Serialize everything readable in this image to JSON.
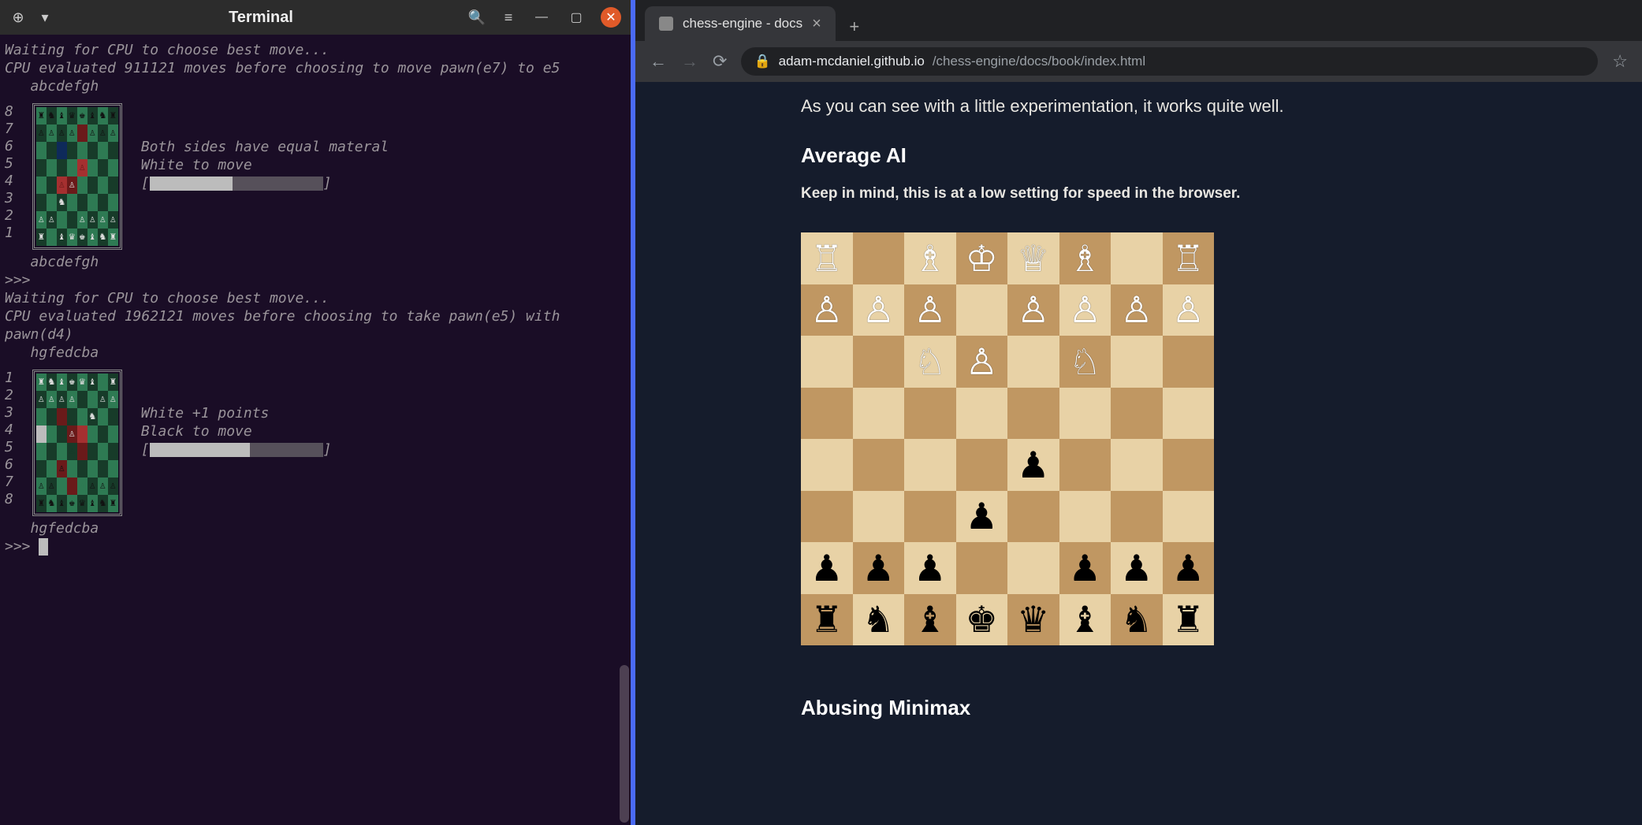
{
  "terminal": {
    "title": "Terminal",
    "lines_top": [
      "Waiting for CPU to choose best move...",
      "CPU evaluated 911121 moves before choosing to move pawn(e7) to e5",
      "   abcdefgh"
    ],
    "board1": {
      "ranks": [
        "8",
        "7",
        "6",
        "5",
        "4",
        "3",
        "2",
        "1"
      ],
      "files_label": "   abcdefgh",
      "side": {
        "status": "Both sides have equal materal",
        "turn": "White to move",
        "bar_open": "[",
        "bar_close": "]",
        "progress_pct": 48
      },
      "squares": [
        [
          {
            "c": "#2e7a53",
            "g": "♜",
            "gc": "#111"
          },
          {
            "c": "#173b29",
            "g": "♞",
            "gc": "#111"
          },
          {
            "c": "#2e7a53",
            "g": "♝",
            "gc": "#111"
          },
          {
            "c": "#173b29",
            "g": "♛",
            "gc": "#111"
          },
          {
            "c": "#2e7a53",
            "g": "♚",
            "gc": "#111"
          },
          {
            "c": "#173b29",
            "g": "♝",
            "gc": "#111"
          },
          {
            "c": "#2e7a53",
            "g": "♞",
            "gc": "#111"
          },
          {
            "c": "#173b29",
            "g": "♜",
            "gc": "#111"
          }
        ],
        [
          {
            "c": "#173b29",
            "g": "♙",
            "gc": "#111"
          },
          {
            "c": "#2e7a53",
            "g": "♙",
            "gc": "#111"
          },
          {
            "c": "#173b29",
            "g": "♙",
            "gc": "#111"
          },
          {
            "c": "#2e7a53",
            "g": "♙",
            "gc": "#111"
          },
          {
            "c": "#6a1a1a",
            "g": ""
          },
          {
            "c": "#2e7a53",
            "g": "♙",
            "gc": "#111"
          },
          {
            "c": "#173b29",
            "g": "♙",
            "gc": "#111"
          },
          {
            "c": "#2e7a53",
            "g": "♙",
            "gc": "#111"
          }
        ],
        [
          {
            "c": "#2e7a53",
            "g": ""
          },
          {
            "c": "#173b29",
            "g": ""
          },
          {
            "c": "#0e2a5a",
            "g": ""
          },
          {
            "c": "#173b29",
            "g": ""
          },
          {
            "c": "#2e7a53",
            "g": ""
          },
          {
            "c": "#173b29",
            "g": ""
          },
          {
            "c": "#2e7a53",
            "g": ""
          },
          {
            "c": "#173b29",
            "g": ""
          }
        ],
        [
          {
            "c": "#173b29",
            "g": ""
          },
          {
            "c": "#2e7a53",
            "g": ""
          },
          {
            "c": "#173b29",
            "g": ""
          },
          {
            "c": "#2e7a53",
            "g": ""
          },
          {
            "c": "#a53030",
            "g": "♙",
            "gc": "#6a1a1a"
          },
          {
            "c": "#2e7a53",
            "g": ""
          },
          {
            "c": "#173b29",
            "g": ""
          },
          {
            "c": "#2e7a53",
            "g": ""
          }
        ],
        [
          {
            "c": "#2e7a53",
            "g": ""
          },
          {
            "c": "#173b29",
            "g": ""
          },
          {
            "c": "#a53030",
            "g": "♙",
            "gc": "#6a1a1a"
          },
          {
            "c": "#6a1a1a",
            "g": "♙",
            "gc": "#ddd"
          },
          {
            "c": "#2e7a53",
            "g": ""
          },
          {
            "c": "#173b29",
            "g": ""
          },
          {
            "c": "#2e7a53",
            "g": ""
          },
          {
            "c": "#173b29",
            "g": ""
          }
        ],
        [
          {
            "c": "#173b29",
            "g": ""
          },
          {
            "c": "#2e7a53",
            "g": ""
          },
          {
            "c": "#173b29",
            "g": "♞",
            "gc": "#ddd"
          },
          {
            "c": "#2e7a53",
            "g": ""
          },
          {
            "c": "#173b29",
            "g": ""
          },
          {
            "c": "#2e7a53",
            "g": ""
          },
          {
            "c": "#173b29",
            "g": ""
          },
          {
            "c": "#2e7a53",
            "g": ""
          }
        ],
        [
          {
            "c": "#2e7a53",
            "g": "♙",
            "gc": "#ddd"
          },
          {
            "c": "#173b29",
            "g": "♙",
            "gc": "#ddd"
          },
          {
            "c": "#2e7a53",
            "g": ""
          },
          {
            "c": "#173b29",
            "g": ""
          },
          {
            "c": "#2e7a53",
            "g": "♙",
            "gc": "#ddd"
          },
          {
            "c": "#173b29",
            "g": "♙",
            "gc": "#ddd"
          },
          {
            "c": "#2e7a53",
            "g": "♙",
            "gc": "#ddd"
          },
          {
            "c": "#173b29",
            "g": "♙",
            "gc": "#ddd"
          }
        ],
        [
          {
            "c": "#173b29",
            "g": "♜",
            "gc": "#ddd"
          },
          {
            "c": "#2e7a53",
            "g": ""
          },
          {
            "c": "#173b29",
            "g": "♝",
            "gc": "#ddd"
          },
          {
            "c": "#2e7a53",
            "g": "♛",
            "gc": "#ddd"
          },
          {
            "c": "#173b29",
            "g": "♚",
            "gc": "#ddd"
          },
          {
            "c": "#2e7a53",
            "g": "♝",
            "gc": "#ddd"
          },
          {
            "c": "#173b29",
            "g": "♞",
            "gc": "#ddd"
          },
          {
            "c": "#2e7a53",
            "g": "♜",
            "gc": "#ddd"
          }
        ]
      ]
    },
    "lines_mid": [
      "",
      ">>>",
      "Waiting for CPU to choose best move...",
      "CPU evaluated 1962121 moves before choosing to take pawn(e5) with pawn(d4)",
      "   hgfedcba"
    ],
    "board2": {
      "ranks": [
        "1",
        "2",
        "3",
        "4",
        "5",
        "6",
        "7",
        "8"
      ],
      "files_label": "   hgfedcba",
      "side": {
        "status": "White +1 points",
        "turn": "Black to move",
        "bar_open": "[",
        "bar_close": "]",
        "progress_pct": 58
      },
      "squares": [
        [
          {
            "c": "#2e7a53",
            "g": "♜",
            "gc": "#ddd"
          },
          {
            "c": "#173b29",
            "g": "♞",
            "gc": "#ddd"
          },
          {
            "c": "#2e7a53",
            "g": "♝",
            "gc": "#ddd"
          },
          {
            "c": "#173b29",
            "g": "♚",
            "gc": "#ddd"
          },
          {
            "c": "#2e7a53",
            "g": "♛",
            "gc": "#ddd"
          },
          {
            "c": "#173b29",
            "g": "♝",
            "gc": "#ddd"
          },
          {
            "c": "#2e7a53",
            "g": ""
          },
          {
            "c": "#173b29",
            "g": "♜",
            "gc": "#ddd"
          }
        ],
        [
          {
            "c": "#173b29",
            "g": "♙",
            "gc": "#ddd"
          },
          {
            "c": "#2e7a53",
            "g": "♙",
            "gc": "#ddd"
          },
          {
            "c": "#173b29",
            "g": "♙",
            "gc": "#ddd"
          },
          {
            "c": "#2e7a53",
            "g": "♙",
            "gc": "#ddd"
          },
          {
            "c": "#173b29",
            "g": ""
          },
          {
            "c": "#2e7a53",
            "g": ""
          },
          {
            "c": "#173b29",
            "g": "♙",
            "gc": "#ddd"
          },
          {
            "c": "#2e7a53",
            "g": "♙",
            "gc": "#ddd"
          }
        ],
        [
          {
            "c": "#2e7a53",
            "g": ""
          },
          {
            "c": "#173b29",
            "g": ""
          },
          {
            "c": "#6a1a1a",
            "g": ""
          },
          {
            "c": "#173b29",
            "g": ""
          },
          {
            "c": "#2e7a53",
            "g": ""
          },
          {
            "c": "#173b29",
            "g": "♞",
            "gc": "#ddd"
          },
          {
            "c": "#2e7a53",
            "g": ""
          },
          {
            "c": "#173b29",
            "g": ""
          }
        ],
        [
          {
            "c": "#bcbcbc",
            "g": ""
          },
          {
            "c": "#2e7a53",
            "g": ""
          },
          {
            "c": "#173b29",
            "g": ""
          },
          {
            "c": "#6a1a1a",
            "g": "♙",
            "gc": "#ddd"
          },
          {
            "c": "#a53030",
            "g": ""
          },
          {
            "c": "#2e7a53",
            "g": ""
          },
          {
            "c": "#173b29",
            "g": ""
          },
          {
            "c": "#2e7a53",
            "g": ""
          }
        ],
        [
          {
            "c": "#2e7a53",
            "g": ""
          },
          {
            "c": "#173b29",
            "g": ""
          },
          {
            "c": "#2e7a53",
            "g": ""
          },
          {
            "c": "#173b29",
            "g": "♙",
            "gc": "#173b29"
          },
          {
            "c": "#6a1a1a",
            "g": ""
          },
          {
            "c": "#173b29",
            "g": ""
          },
          {
            "c": "#2e7a53",
            "g": ""
          },
          {
            "c": "#173b29",
            "g": ""
          }
        ],
        [
          {
            "c": "#173b29",
            "g": ""
          },
          {
            "c": "#2e7a53",
            "g": ""
          },
          {
            "c": "#6a1a1a",
            "g": "♙",
            "gc": "#111"
          },
          {
            "c": "#2e7a53",
            "g": ""
          },
          {
            "c": "#173b29",
            "g": ""
          },
          {
            "c": "#2e7a53",
            "g": ""
          },
          {
            "c": "#173b29",
            "g": ""
          },
          {
            "c": "#2e7a53",
            "g": ""
          }
        ],
        [
          {
            "c": "#2e7a53",
            "g": "♙",
            "gc": "#111"
          },
          {
            "c": "#173b29",
            "g": "♙",
            "gc": "#111"
          },
          {
            "c": "#2e7a53",
            "g": ""
          },
          {
            "c": "#6a1a1a",
            "g": ""
          },
          {
            "c": "#2e7a53",
            "g": "♙",
            "gc": "#2e7a53"
          },
          {
            "c": "#173b29",
            "g": "♙",
            "gc": "#111"
          },
          {
            "c": "#2e7a53",
            "g": "♙",
            "gc": "#111"
          },
          {
            "c": "#173b29",
            "g": "♙",
            "gc": "#111"
          }
        ],
        [
          {
            "c": "#173b29",
            "g": "♜",
            "gc": "#111"
          },
          {
            "c": "#2e7a53",
            "g": "♞",
            "gc": "#111"
          },
          {
            "c": "#173b29",
            "g": "♝",
            "gc": "#111"
          },
          {
            "c": "#2e7a53",
            "g": "♚",
            "gc": "#111"
          },
          {
            "c": "#173b29",
            "g": "♛",
            "gc": "#111"
          },
          {
            "c": "#2e7a53",
            "g": "♝",
            "gc": "#111"
          },
          {
            "c": "#173b29",
            "g": "♞",
            "gc": "#111"
          },
          {
            "c": "#2e7a53",
            "g": "♜",
            "gc": "#111"
          }
        ]
      ]
    },
    "lines_end": [
      ""
    ],
    "prompt": ">>> "
  },
  "browser": {
    "tab_title": "chess-engine - docs",
    "url_host": "adam-mcdaniel.github.io",
    "url_path": "/chess-engine/docs/book/index.html",
    "page": {
      "intro": "As you can see with a little experimentation, it works quite well.",
      "h_average": "Average AI",
      "note": "Keep in mind, this is at a low setting for speed in the browser.",
      "h_abusing": "Abusing Minimax",
      "board": [
        [
          {
            "p": "R",
            "c": "w"
          },
          {
            "p": "",
            "c": ""
          },
          {
            "p": "B",
            "c": "w"
          },
          {
            "p": "K",
            "c": "w"
          },
          {
            "p": "Q",
            "c": "w"
          },
          {
            "p": "B",
            "c": "w"
          },
          {
            "p": "",
            "c": ""
          },
          {
            "p": "R",
            "c": "w"
          }
        ],
        [
          {
            "p": "P",
            "c": "w"
          },
          {
            "p": "P",
            "c": "w"
          },
          {
            "p": "P",
            "c": "w"
          },
          {
            "p": "",
            "c": ""
          },
          {
            "p": "P",
            "c": "w"
          },
          {
            "p": "P",
            "c": "w"
          },
          {
            "p": "P",
            "c": "w"
          },
          {
            "p": "P",
            "c": "w"
          }
        ],
        [
          {
            "p": "",
            "c": ""
          },
          {
            "p": "",
            "c": ""
          },
          {
            "p": "N",
            "c": "w"
          },
          {
            "p": "P",
            "c": "w"
          },
          {
            "p": "",
            "c": ""
          },
          {
            "p": "N",
            "c": "w"
          },
          {
            "p": "",
            "c": ""
          },
          {
            "p": "",
            "c": ""
          }
        ],
        [
          {
            "p": "",
            "c": ""
          },
          {
            "p": "",
            "c": ""
          },
          {
            "p": "",
            "c": ""
          },
          {
            "p": "",
            "c": ""
          },
          {
            "p": "",
            "c": ""
          },
          {
            "p": "",
            "c": ""
          },
          {
            "p": "",
            "c": ""
          },
          {
            "p": "",
            "c": ""
          }
        ],
        [
          {
            "p": "",
            "c": ""
          },
          {
            "p": "",
            "c": ""
          },
          {
            "p": "",
            "c": ""
          },
          {
            "p": "",
            "c": ""
          },
          {
            "p": "P",
            "c": "b"
          },
          {
            "p": "",
            "c": ""
          },
          {
            "p": "",
            "c": ""
          },
          {
            "p": "",
            "c": ""
          }
        ],
        [
          {
            "p": "",
            "c": ""
          },
          {
            "p": "",
            "c": ""
          },
          {
            "p": "",
            "c": ""
          },
          {
            "p": "P",
            "c": "b"
          },
          {
            "p": "",
            "c": ""
          },
          {
            "p": "",
            "c": ""
          },
          {
            "p": "",
            "c": ""
          },
          {
            "p": "",
            "c": ""
          }
        ],
        [
          {
            "p": "P",
            "c": "b"
          },
          {
            "p": "P",
            "c": "b"
          },
          {
            "p": "P",
            "c": "b"
          },
          {
            "p": "",
            "c": ""
          },
          {
            "p": "",
            "c": ""
          },
          {
            "p": "P",
            "c": "b"
          },
          {
            "p": "P",
            "c": "b"
          },
          {
            "p": "P",
            "c": "b"
          }
        ],
        [
          {
            "p": "R",
            "c": "b"
          },
          {
            "p": "N",
            "c": "b"
          },
          {
            "p": "B",
            "c": "b"
          },
          {
            "p": "K",
            "c": "b"
          },
          {
            "p": "Q",
            "c": "b"
          },
          {
            "p": "B",
            "c": "b"
          },
          {
            "p": "N",
            "c": "b"
          },
          {
            "p": "R",
            "c": "b"
          }
        ]
      ]
    }
  },
  "pieces": {
    "K": "♔",
    "Q": "♕",
    "R": "♖",
    "B": "♗",
    "N": "♘",
    "P": "♙",
    "k": "♚",
    "q": "♛",
    "r": "♜",
    "b": "♝",
    "n": "♞",
    "p": "♟"
  }
}
